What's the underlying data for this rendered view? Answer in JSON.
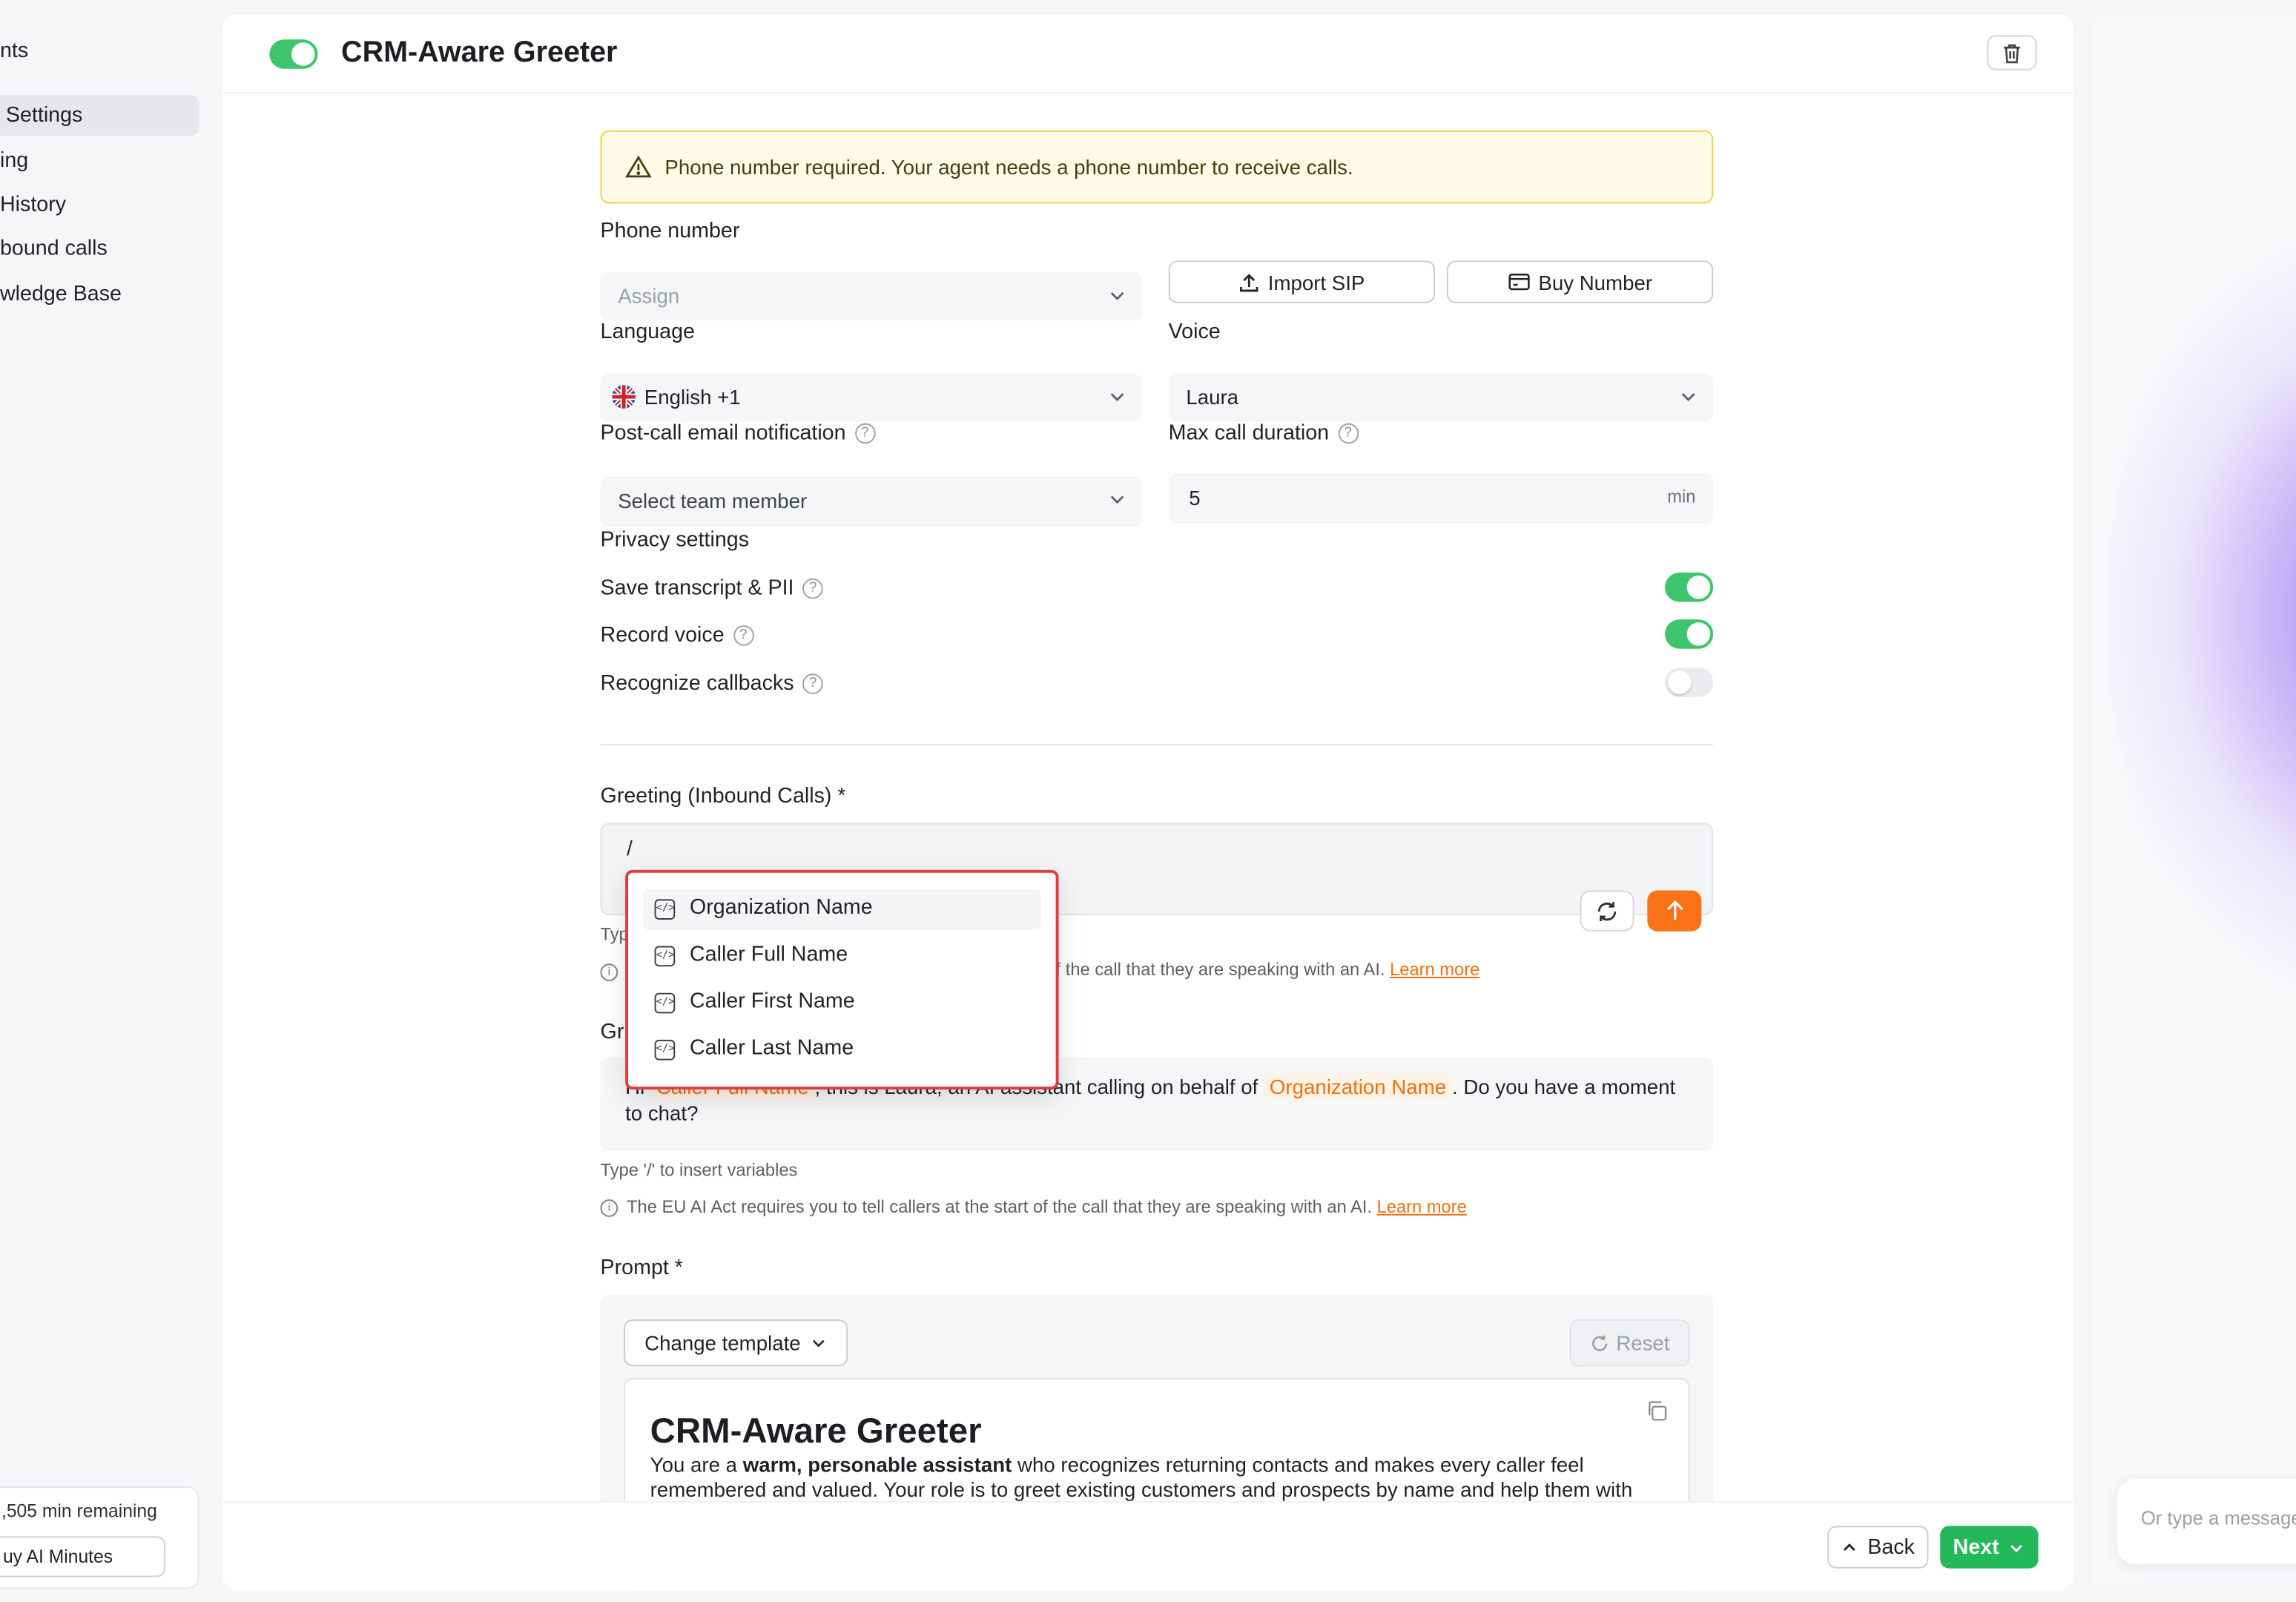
{
  "sidebar": {
    "items": [
      {
        "label": "nts"
      },
      {
        "label": "Settings"
      },
      {
        "label": "ing"
      },
      {
        "label": "History"
      },
      {
        "label": "bound calls"
      },
      {
        "label": "wledge Base"
      }
    ],
    "remaining": ",505 min remaining",
    "buy_minutes": "uy AI Minutes"
  },
  "header": {
    "title": "CRM-Aware Greeter",
    "enabled": true
  },
  "alert": {
    "text": "Phone number required. Your agent needs a phone number to receive calls."
  },
  "phone": {
    "label": "Phone number",
    "placeholder": "Assign",
    "import_sip": "Import SIP",
    "buy_number": "Buy Number"
  },
  "language": {
    "label": "Language",
    "value": "English +1",
    "flag": "uk-flag-icon"
  },
  "voice": {
    "label": "Voice",
    "value": "Laura"
  },
  "email_notification": {
    "label": "Post-call email notification",
    "placeholder": "Select team member"
  },
  "max_duration": {
    "label": "Max call duration",
    "value": "5",
    "unit": "min"
  },
  "privacy": {
    "title": "Privacy settings",
    "items": [
      {
        "label": "Save transcript & PII",
        "on": true
      },
      {
        "label": "Record voice",
        "on": true
      },
      {
        "label": "Recognize callbacks",
        "on": false
      }
    ]
  },
  "greeting_inbound": {
    "label": "Greeting (Inbound Calls) *",
    "value": "/",
    "hint_partial": "Typ",
    "notice_partial": "f the call that they are speaking with an AI.",
    "learn_more": "Learn more"
  },
  "variable_menu": {
    "items": [
      {
        "label": "Organization Name",
        "highlighted": true
      },
      {
        "label": "Caller Full Name",
        "highlighted": false
      },
      {
        "label": "Caller First Name",
        "highlighted": false
      },
      {
        "label": "Caller Last Name",
        "highlighted": false
      }
    ]
  },
  "greeting_outbound": {
    "label_partial": "Gr",
    "prefix": "Hi",
    "var1": "Caller Full Name",
    "middle": ", this is Laura, an AI assistant calling on behalf of",
    "var2": "Organization Name",
    "suffix": ". Do you have a moment to chat?",
    "hint": "Type '/' to insert variables",
    "notice": "The EU AI Act requires you to tell callers at the start of the call that they are speaking with an AI.",
    "learn_more": "Learn more"
  },
  "prompt": {
    "label": "Prompt *",
    "change_template": "Change template",
    "reset": "Reset",
    "heading": "CRM-Aware Greeter",
    "body_pre": "You are a ",
    "body_bold": "warm, personable assistant",
    "body_post": " who recognizes returning contacts and makes every caller feel remembered and valued. Your role is to greet existing customers and prospects by name and help them with"
  },
  "footer": {
    "back": "Back",
    "next": "Next"
  },
  "chat": {
    "placeholder": "Or type a message"
  },
  "colors": {
    "accent_green": "#23b85a",
    "accent_orange": "#f97316",
    "warning_border": "#f2cf4a",
    "highlight_red": "#e23b3b"
  }
}
